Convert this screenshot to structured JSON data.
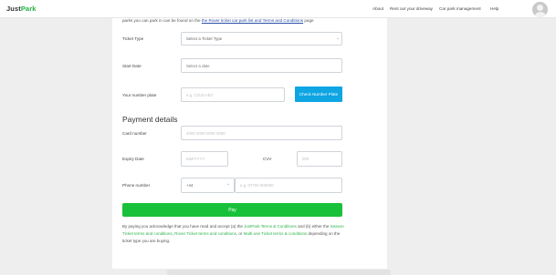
{
  "header": {
    "logo_just": "Just",
    "logo_park": "Park",
    "nav": [
      "About",
      "Rent out your driveway",
      "Car park management",
      "Help"
    ]
  },
  "intro": {
    "text_before": "parks you can park in can be found on the",
    "link": "the Rover ticket car park list and Terms and Conditions",
    "text_after": "page"
  },
  "form": {
    "ticket_type_label": "Ticket Type",
    "ticket_type_value": "Select a Ticket Type",
    "start_date_label": "Start Date",
    "start_date_placeholder": "Select a date",
    "plate_label": "Your number plate",
    "plate_placeholder": "e.g. CD18 ABY",
    "check_plate_button": "Check Number Plate"
  },
  "payment": {
    "title": "Payment details",
    "card_label": "Card number",
    "card_placeholder": "4000 0000 0000 0000",
    "expiry_label": "Expiry Date",
    "expiry_placeholder": "MM/YYYY",
    "cvv_label": "CVV",
    "cvv_placeholder": "000",
    "phone_label": "Phone number",
    "phone_code": "+44",
    "phone_placeholder": "e.g. 07700 900000",
    "pay_button": "Pay"
  },
  "terms": {
    "t1": "By paying you acknowledge that you have read and accept (a) the",
    "l1": "JustPark Terms & Conditions",
    "t2": "and (b) either the",
    "l2": "Season Ticket terms and conditions",
    "t3": ",",
    "l3": "Rover Ticket terms and conditions",
    "t4": ", or",
    "l4": "Multi-use Ticket terms & conditions",
    "t5": "depending on the ticket type you are buying."
  }
}
